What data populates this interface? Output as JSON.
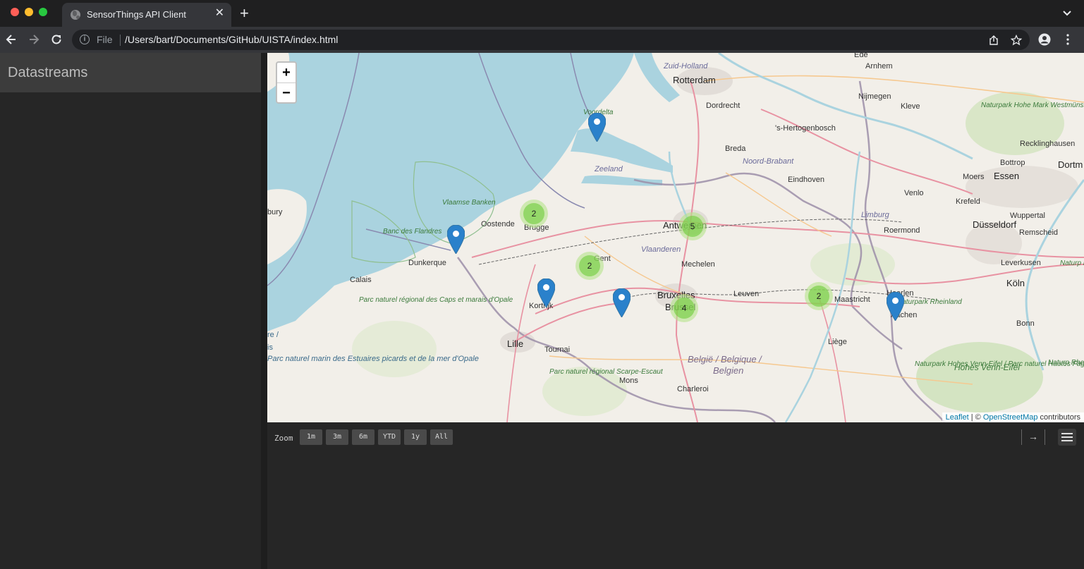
{
  "browser": {
    "tab_title": "SensorThings API Client",
    "tab_close": "✕",
    "new_tab": "+",
    "file_label": "File",
    "url": "/Users/bart/Documents/GitHub/UISTA/index.html",
    "info_icon": "i"
  },
  "sidebar": {
    "title": "Datastreams"
  },
  "map": {
    "zoom_in": "+",
    "zoom_out": "−",
    "attribution": {
      "leaflet": "Leaflet",
      "sep": " | © ",
      "osm": "OpenStreetMap",
      "suffix": " contributors"
    },
    "clusters": [
      "2",
      "5",
      "2",
      "2",
      "4"
    ],
    "places": {
      "rotterdam": "Rotterdam",
      "zuid_holland": "Zuid-Holland",
      "ede": "Ede",
      "arnhem": "Arnhem",
      "dordrecht": "Dordrecht",
      "nijmegen": "Nijmegen",
      "kleve": "Kleve",
      "voordelta": "Voordelta",
      "hertogenbosch": "'s-Hertogenbosch",
      "breda": "Breda",
      "zeeland": "Zeeland",
      "noord_brabant": "Noord-Brabant",
      "eindhoven": "Eindhoven",
      "venlo": "Venlo",
      "moers": "Moers",
      "essen": "Essen",
      "bottrop": "Bottrop",
      "recklinghausen": "Recklinghausen",
      "dortm": "Dortm",
      "krefeld": "Krefeld",
      "wuppertal": "Wuppertal",
      "dusseldorf": "Düsseldorf",
      "remscheid": "Remscheid",
      "limburg": "Limburg",
      "roermond": "Roermond",
      "leverkusen": "Leverkusen",
      "koln": "Köln",
      "oostende": "Oostende",
      "brugge": "Brugge",
      "antwerpen": "Antwerpen",
      "dunkerque": "Dunkerque",
      "calais": "Calais",
      "mechelen": "Mechelen",
      "vlaanderen": "Vlaanderen",
      "gent": "Gent",
      "kortrijk": "Kortrijk",
      "bruxelles": "Bruxelles",
      "brussel": "Brussel",
      "leuven": "Leuven",
      "maastricht": "Maastricht",
      "heerlen": "Heerlen",
      "aachen": "Aachen",
      "lille": "Lille",
      "tournai": "Tournai",
      "liege": "Liège",
      "belgie": "België / Belgique /",
      "belgien": "Belgien",
      "mons": "Mons",
      "charleroi": "Charleroi",
      "bonn": "Bonn",
      "hohes_venn": "Hohes Venn-Eifel",
      "bury": "bury",
      "vlaamse_banken": "Vlaamse Banken",
      "banc_des_flandres": "Banc des Flandres",
      "naturpark_hohe_mark": "Naturpark Hohe Mark Westmünsterland",
      "parc_caps": "Parc naturel régional des Caps et marais d'Opale",
      "parc_marin": "Parc naturel marin des Estuaires picards et de la mer d'Opale",
      "parc_opale": "Parc naturel",
      "parc_scarpe": "Parc naturel régional Scarpe-Escaut",
      "naturpark_rheinland": "Naturpark Rheinland",
      "naturpark_eifel": "Naturpark Hohes Venn-Eifel / Parc naturel Hautes Fagnes",
      "naturp_bergis": "Naturp Bergis",
      "naturp_rhein": "Naturp Rhein-Wes",
      "re": "re /",
      "is": "is"
    }
  },
  "chart": {
    "zoom_label": "Zoom",
    "ranges": [
      "1m",
      "3m",
      "6m",
      "YTD",
      "1y",
      "All"
    ],
    "nav": "→"
  },
  "colors": {
    "sea": "#aad3df",
    "land": "#f2efe9",
    "marker": "#2a81cb",
    "cluster_outer": "#b5e28c",
    "cluster_inner": "#6ecc39"
  }
}
